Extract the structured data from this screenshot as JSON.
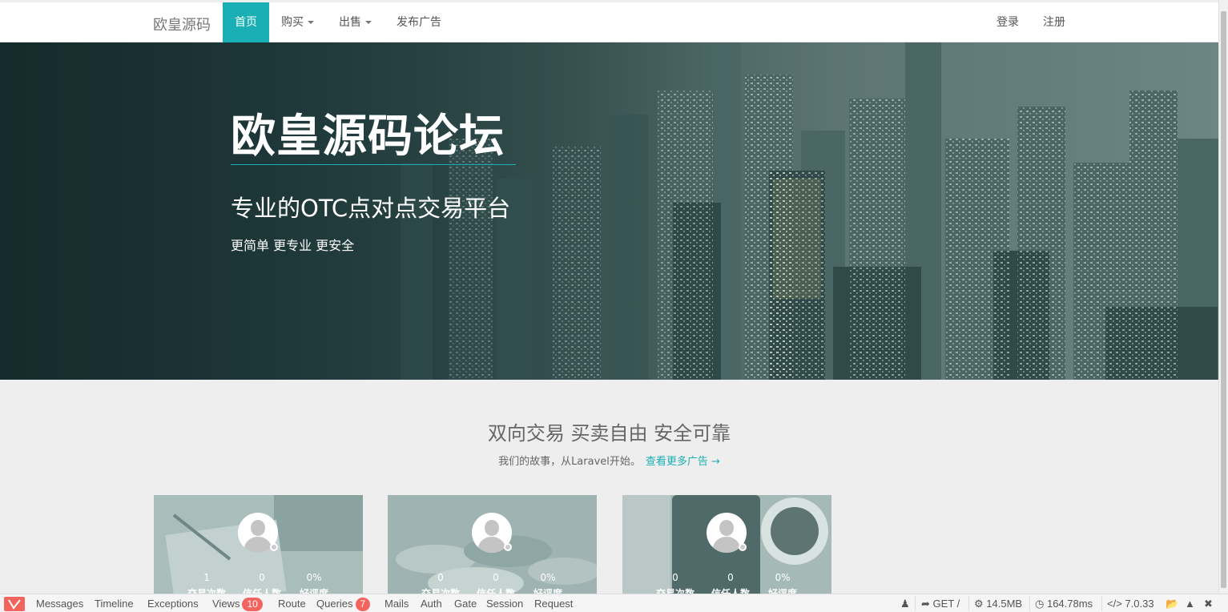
{
  "navbar": {
    "brand": "欧皇源码",
    "items": [
      {
        "label": "首页",
        "active": true
      },
      {
        "label": "购买",
        "dropdown": true
      },
      {
        "label": "出售",
        "dropdown": true
      },
      {
        "label": "发布广告"
      }
    ],
    "right": {
      "login": "登录",
      "register": "注册"
    }
  },
  "hero": {
    "title": "欧皇源码论坛",
    "subtitle": "专业的OTC点对点交易平台",
    "tagline": "更简单 更专业 更安全"
  },
  "section": {
    "title": "双向交易 买卖自由 安全可靠",
    "desc": "我们的故事，从Laravel开始。",
    "link": "查看更多广告 →"
  },
  "cards": [
    {
      "trades": "1",
      "trust": "0",
      "rating": "0%",
      "label_trades": "交易次数",
      "label_trust": "信任人数",
      "label_rating": "好评度"
    },
    {
      "trades": "0",
      "trust": "0",
      "rating": "0%",
      "label_trades": "交易次数",
      "label_trust": "信任人数",
      "label_rating": "好评度"
    },
    {
      "trades": "0",
      "trust": "0",
      "rating": "0%",
      "label_trades": "交易次数",
      "label_trust": "信任人数",
      "label_rating": "好评度"
    }
  ],
  "debugbar": {
    "tabs": {
      "messages": "Messages",
      "timeline": "Timeline",
      "exceptions": "Exceptions",
      "views": "Views",
      "views_count": "10",
      "route": "Route",
      "queries": "Queries",
      "queries_count": "7",
      "mails": "Mails",
      "auth": "Auth",
      "gate": "Gate",
      "session": "Session",
      "request": "Request"
    },
    "method": "GET /",
    "memory": "14.5MB",
    "time": "164.78ms",
    "php_version": "7.0.33"
  },
  "colors": {
    "accent": "#1aafb5",
    "badge": "#f4645f"
  }
}
